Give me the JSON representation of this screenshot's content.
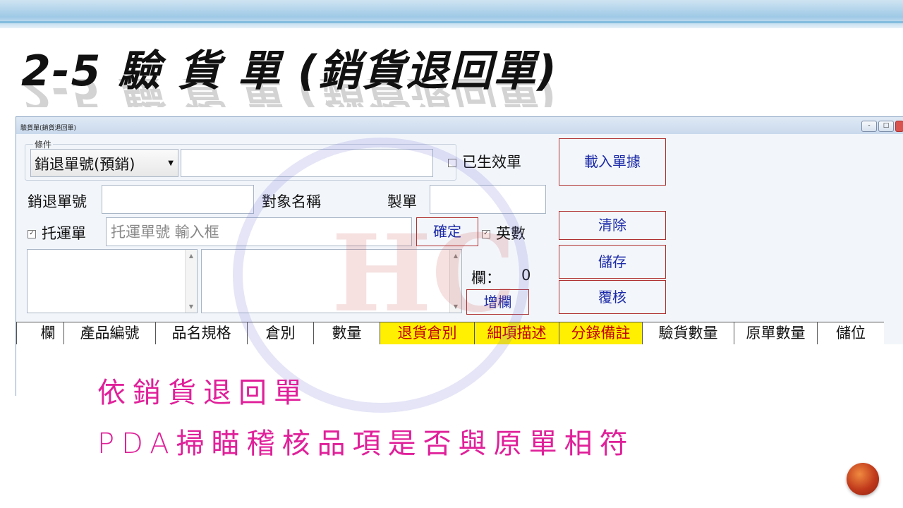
{
  "slide": {
    "title": "2-5 驗 貨 單 (銷貨退回單)",
    "notes": [
      "依銷貨退回單",
      "PDA掃瞄稽核品項是否與原單相符"
    ]
  },
  "window": {
    "title": "驗貨單(銷貨退回單)",
    "controls": [
      "-",
      "□",
      "×"
    ]
  },
  "conditions": {
    "group_label": "條件",
    "combo_value": "銷退單號(預銷)",
    "search_value": "",
    "effective_checkbox": {
      "label": "已生效單",
      "checked": false
    }
  },
  "form": {
    "return_no_label": "銷退單號",
    "return_no_value": "",
    "target_name_label": "對象名稱",
    "maker_label": "製單",
    "maker_value": "",
    "shipping_checkbox": {
      "label": "托運單",
      "checked": true
    },
    "shipping_placeholder": "托運單號 輸入框",
    "confirm_label": "確定",
    "alnum_checkbox": {
      "label": "英數",
      "checked": true
    },
    "column_count_label": "欄：",
    "column_count_value": "0",
    "add_column_label": "增欄"
  },
  "buttons": {
    "load": "載入單據",
    "clear": "清除",
    "save": "儲存",
    "recheck": "覆核"
  },
  "grid": {
    "columns": [
      {
        "label": "欄",
        "highlight": false
      },
      {
        "label": "產品編號",
        "highlight": false
      },
      {
        "label": "品名規格",
        "highlight": false
      },
      {
        "label": "倉別",
        "highlight": false
      },
      {
        "label": "數量",
        "highlight": false
      },
      {
        "label": "退貨倉別",
        "highlight": true
      },
      {
        "label": "細項描述",
        "highlight": true
      },
      {
        "label": "分錄備註",
        "highlight": true
      },
      {
        "label": "驗貨數量",
        "highlight": false
      },
      {
        "label": "原單數量",
        "highlight": false
      },
      {
        "label": "儲位",
        "highlight": false
      }
    ],
    "rows": []
  },
  "colors": {
    "highlight_bg": "#ffef00",
    "highlight_text": "#c00000",
    "note_text": "#e0209a",
    "button_text": "#1b2aa8"
  }
}
